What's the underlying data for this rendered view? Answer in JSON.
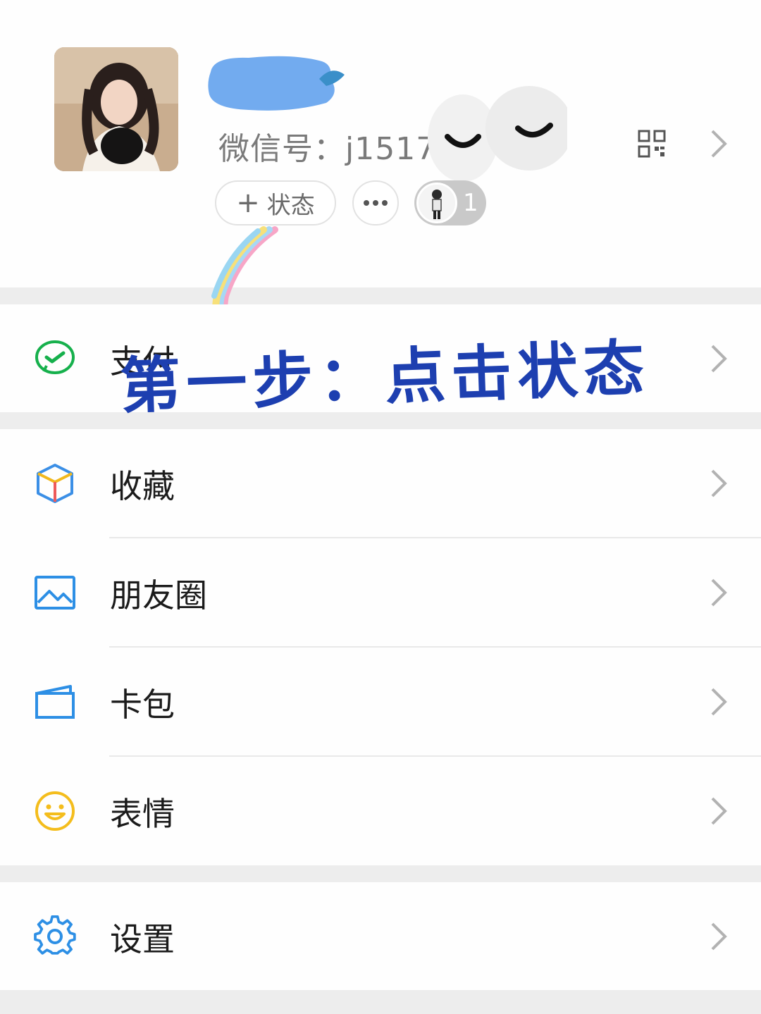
{
  "profile": {
    "wechat_id_label": "微信号：",
    "wechat_id_value": "j1517",
    "status_button_label": "状态",
    "status_button_prefix": "+",
    "friend_status_count": "1"
  },
  "annotation": {
    "handwritten_text": "第一步：点击状态"
  },
  "menu": {
    "pay": "支付",
    "favorites": "收藏",
    "moments": "朋友圈",
    "cards": "卡包",
    "stickers": "表情",
    "settings": "设置"
  },
  "colors": {
    "pay_icon": "#16b04c",
    "moments_icon": "#2d8fe5",
    "cards_icon": "#2d8fe5",
    "stickers_icon": "#f4bd1c",
    "settings_icon": "#2d8fe5",
    "annotation_ink": "#1d3fb0",
    "nickname_blur": "#6aa7ee"
  },
  "icons": {
    "pay": "wechat-pay-icon",
    "favorites": "cube-icon",
    "moments": "image-icon",
    "cards": "wallet-icon",
    "stickers": "smiley-icon",
    "settings": "gear-icon"
  }
}
